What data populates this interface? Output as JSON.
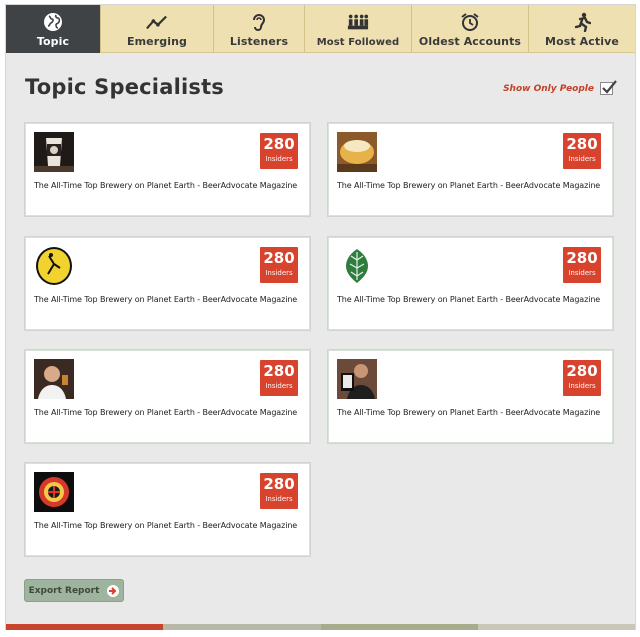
{
  "tabs": [
    {
      "label": "Topic",
      "icon": "globe-icon",
      "active": true
    },
    {
      "label": "Emerging",
      "icon": "trend-line-icon"
    },
    {
      "label": "Listeners",
      "icon": "ear-icon"
    },
    {
      "label": "Most Followed",
      "icon": "crowd-icon"
    },
    {
      "label": "Oldest Accounts",
      "icon": "alarm-clock-icon"
    },
    {
      "label": "Most Active",
      "icon": "running-person-icon"
    }
  ],
  "page": {
    "title": "Topic Specialists",
    "show_only_people_label": "Show Only People",
    "show_only_people_checked": true
  },
  "cards": [
    {
      "count": "280",
      "count_label": "Insiders",
      "text": "The All-Time Top Brewery on Planet Earth - BeerAdvocate Magazine",
      "thumb": "beer-glass-thumbnail"
    },
    {
      "count": "280",
      "count_label": "Insiders",
      "text": "The All-Time Top Brewery on Planet Earth - BeerAdvocate Magazine",
      "thumb": "beer-pour-thumbnail"
    },
    {
      "count": "280",
      "count_label": "Insiders",
      "text": "The All-Time Top Brewery on Planet Earth - BeerAdvocate Magazine",
      "thumb": "brewery-logo-thumbnail"
    },
    {
      "count": "280",
      "count_label": "Insiders",
      "text": "The All-Time Top Brewery on Planet Earth - BeerAdvocate Magazine",
      "thumb": "hop-leaf-thumbnail"
    },
    {
      "count": "280",
      "count_label": "Insiders",
      "text": "The All-Time Top Brewery on Planet Earth - BeerAdvocate Magazine",
      "thumb": "person-photo-thumbnail"
    },
    {
      "count": "280",
      "count_label": "Insiders",
      "text": "The All-Time Top Brewery on Planet Earth - BeerAdvocate Magazine",
      "thumb": "person-with-tablet-thumbnail"
    },
    {
      "count": "280",
      "count_label": "Insiders",
      "text": "The All-Time Top Brewery on Planet Earth - BeerAdvocate Magazine",
      "thumb": "red-badge-logo-thumbnail"
    }
  ],
  "export": {
    "label": "Export Report",
    "icon": "arrow-right-icon"
  },
  "colors": {
    "accent_red": "#d8432d",
    "tab_bg": "#efe0b2",
    "tab_active": "#3f4345",
    "export_green": "#9fb49f",
    "strip": [
      "#c9442e",
      "#b7b8a6",
      "#a5ad8c",
      "#c9c8b8"
    ]
  }
}
